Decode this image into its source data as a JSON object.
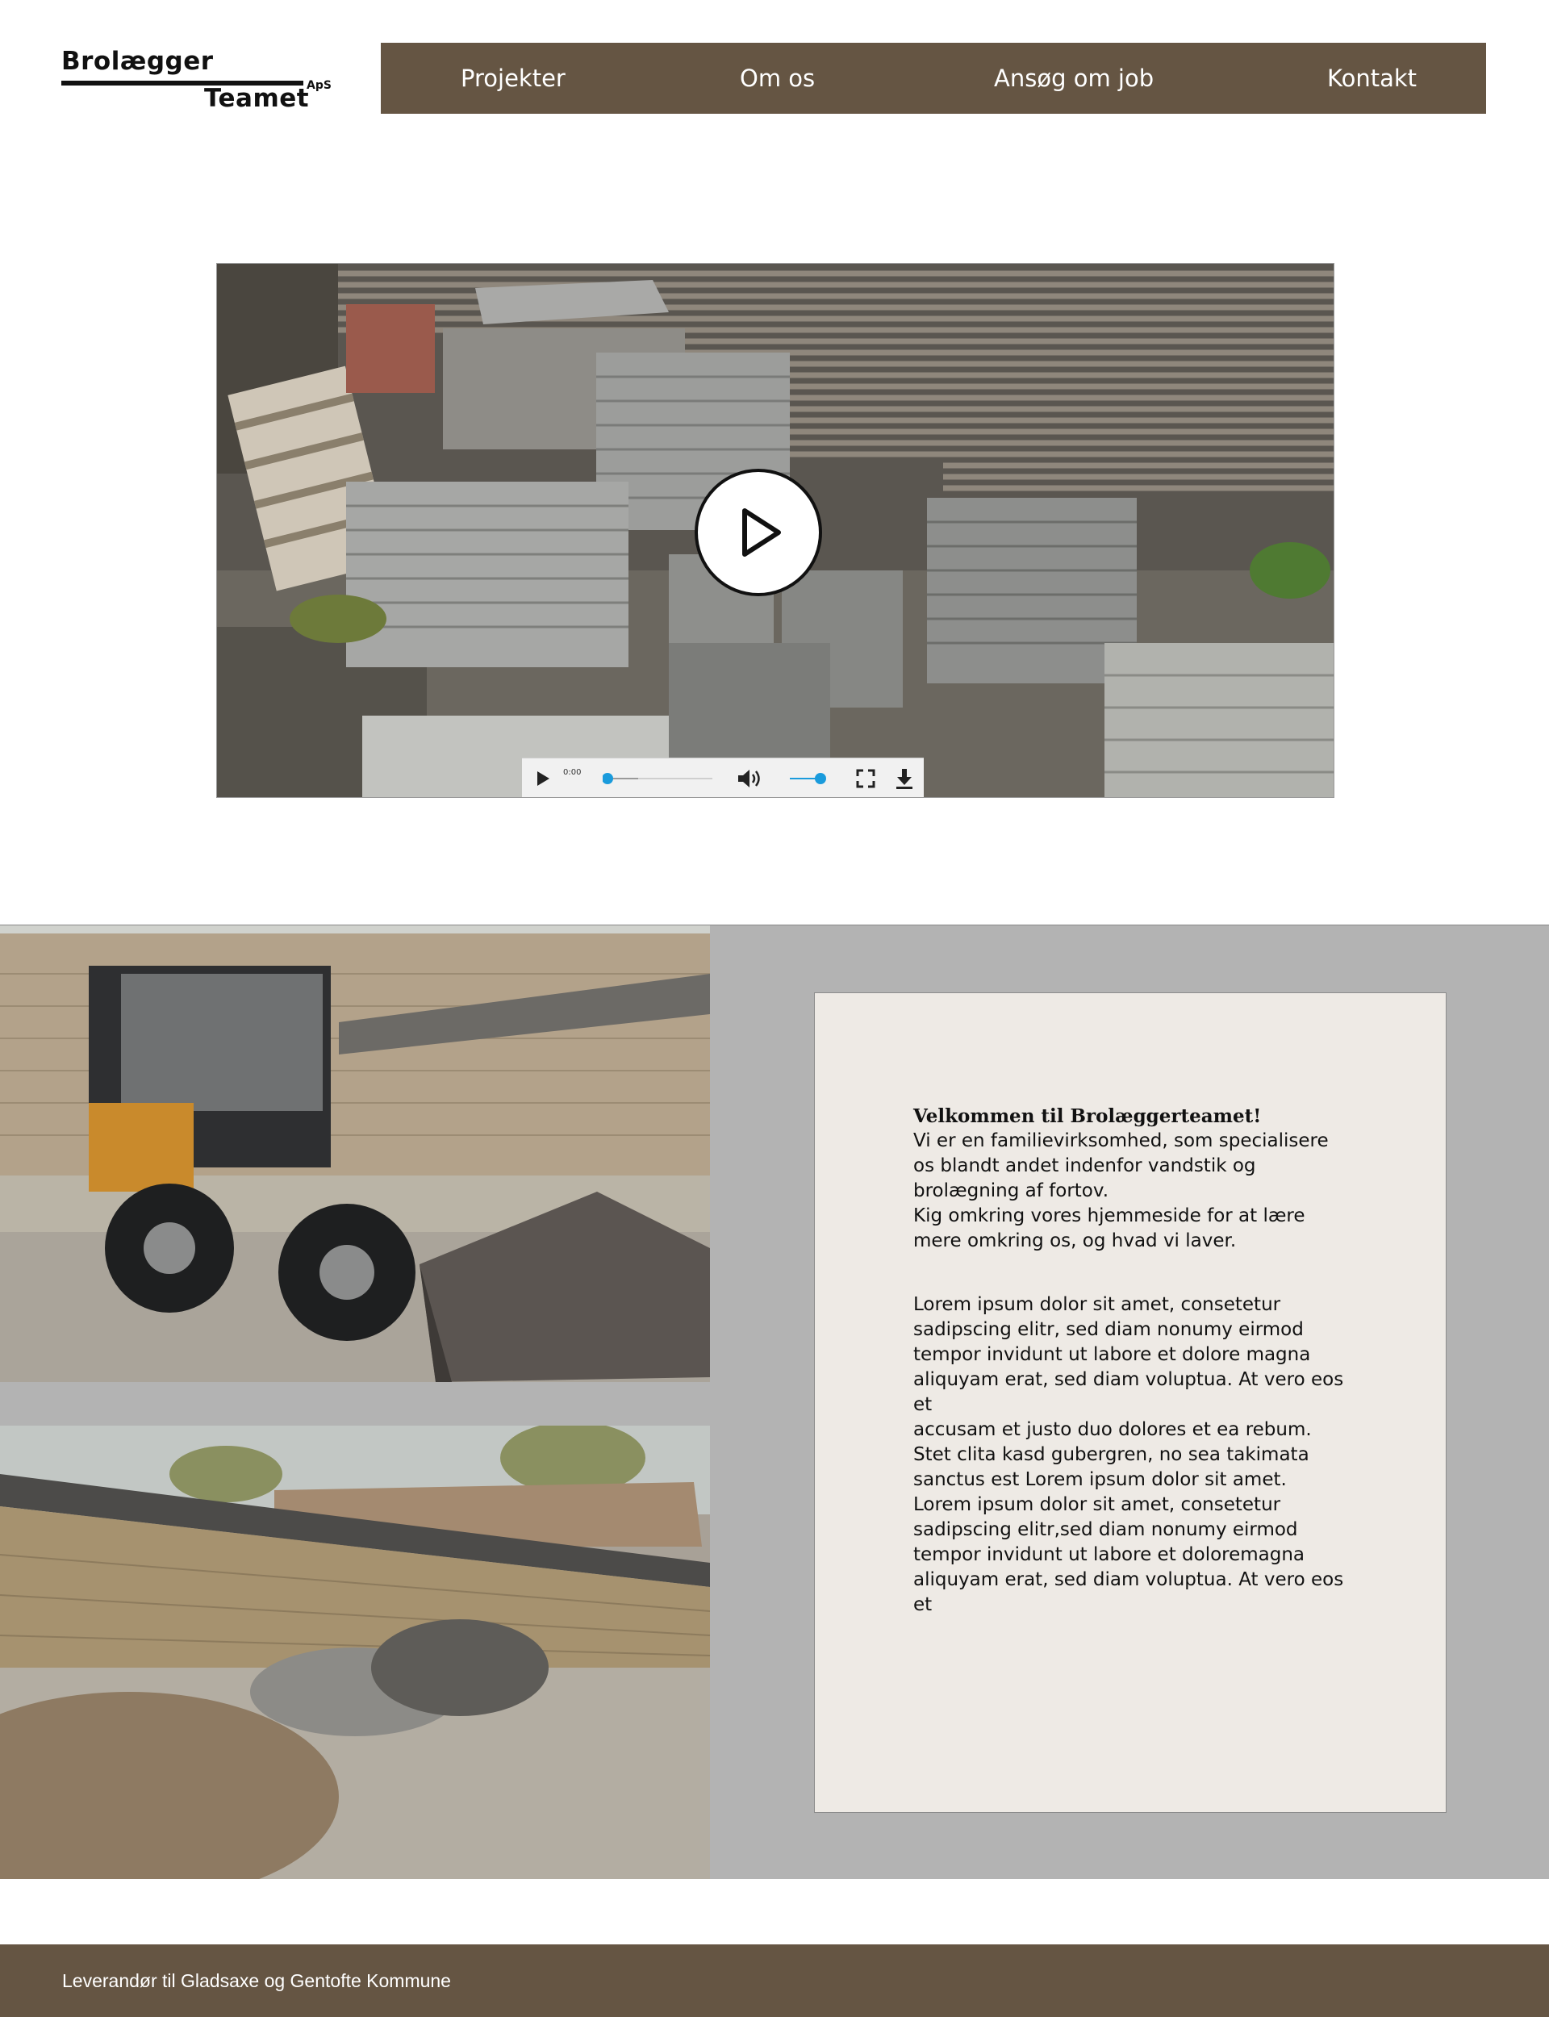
{
  "brand": {
    "line1": "Brolægger",
    "line2": "Teamet",
    "suffix": "ApS"
  },
  "nav": {
    "items": [
      {
        "label": "Projekter"
      },
      {
        "label": "Om os"
      },
      {
        "label": "Ansøg om job"
      },
      {
        "label": "Kontakt"
      }
    ]
  },
  "video": {
    "current_time": "0:00",
    "progress": 0,
    "volume": 1.0,
    "icons": [
      "play-icon",
      "play-small-icon",
      "volume-icon",
      "fullscreen-icon",
      "download-icon"
    ],
    "accent_color": "#1a9bdc"
  },
  "intro": {
    "title": "Velkommen til Brolæggerteamet!",
    "body": "Vi er en familievirksomhed, som specialisere\nos blandt andet indenfor vandstik og\nbrolægning af fortov.\nKig omkring vores hjemmeside for at lære\nmere omkring os, og hvad vi laver.",
    "lorem": "Lorem ipsum dolor sit amet, consetetur\nsadipscing elitr, sed diam nonumy eirmod\ntempor invidunt ut labore et dolore magna\naliquyam erat, sed diam voluptua. At vero eos\net\naccusam et justo duo dolores et ea rebum.\nStet clita kasd gubergren, no sea takimata\nsanctus est Lorem ipsum dolor sit amet.\nLorem ipsum dolor sit amet, consetetur\nsadipscing elitr,sed diam nonumy eirmod\ntempor invidunt ut labore et doloremagna\naliquyam erat, sed diam voluptua. At vero eos\net"
  },
  "footer": {
    "text": "Leverandør til Gladsaxe og Gentofte Kommune"
  },
  "colors": {
    "nav_bg": "#655543",
    "section_bg": "#b3b3b3",
    "card_bg": "#eeeae5"
  }
}
